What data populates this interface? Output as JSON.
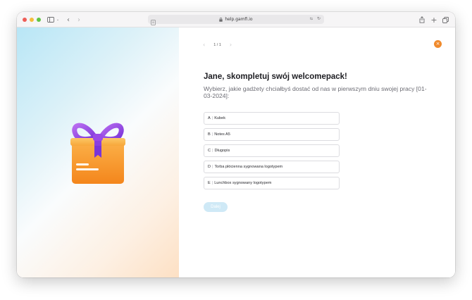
{
  "browser": {
    "url": "help.gamfi.io",
    "traffic_lights": [
      "#ee5d57",
      "#f4bd3b",
      "#5fc443"
    ]
  },
  "pager": {
    "prev_icon": "chevron-left-icon",
    "count": "1 / 1",
    "next_icon": "chevron-right-icon"
  },
  "close_icon": "close-icon",
  "accent_color": "#f08a2c",
  "heading": "Jane, skompletuj swój welcomepack!",
  "subheading": "Wybierz, jakie gadżety chciałbyś dostać od nas w pierwszym dniu swojej pracy [01-03-2024]:",
  "options": [
    {
      "letter": "A",
      "label": "Kubek"
    },
    {
      "letter": "B",
      "label": "Notes A5"
    },
    {
      "letter": "C",
      "label": "Długopis"
    },
    {
      "letter": "D",
      "label": "Torba płócienna sygnowana logotypem"
    },
    {
      "letter": "E",
      "label": "Lunchbox sygnowany logotypem"
    }
  ],
  "next_label": "Dalej"
}
